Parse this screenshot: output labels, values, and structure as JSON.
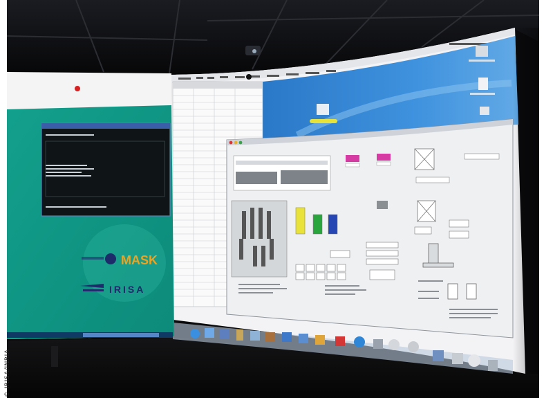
{
  "photo": {
    "subject": "curved-projection-wall",
    "colors": {
      "room": "#0b0b0e",
      "ceiling": "#15161a",
      "mac_desktop": "#2f7fd0",
      "teal_screen": "#17a58f",
      "app_window": "#e8eaec",
      "mask_orange": "#f0a21e"
    }
  },
  "left_screen": {
    "logo_mask": "MASK",
    "logo_irisa": "IRISA"
  },
  "right_screen": {
    "windows": [
      "spreadsheet-window",
      "application-window"
    ],
    "dock_icons": [
      "finder-icon",
      "mail-icon",
      "safari-icon",
      "ical-icon",
      "itunes-icon",
      "trash-icon"
    ]
  },
  "credit": "© IRISA/INRIA"
}
